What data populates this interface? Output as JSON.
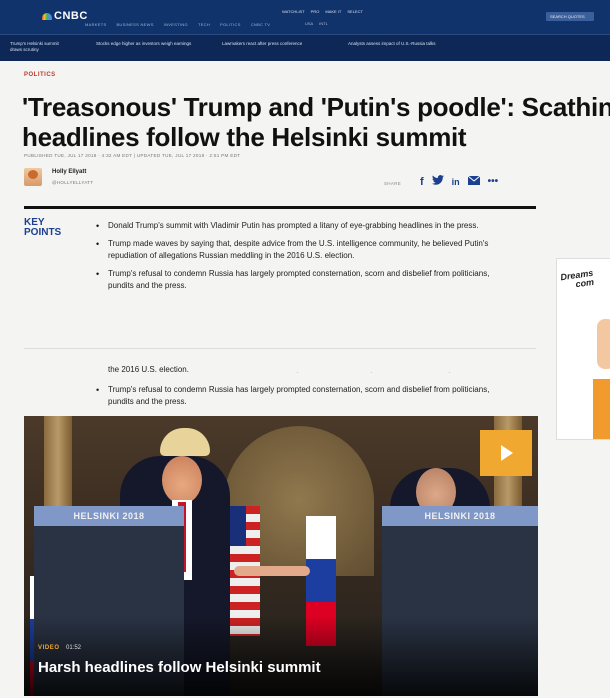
{
  "header": {
    "logo": "CNBC",
    "nav": [
      "MARKETS",
      "BUSINESS NEWS",
      "INVESTING",
      "TECH",
      "POLITICS",
      "CNBC TV"
    ],
    "right_links": [
      "WATCHLIST",
      "PRO",
      "MAKE IT",
      "SELECT"
    ],
    "right_links_row2": [
      "USA",
      "INTL"
    ],
    "search_label": "SEARCH QUOTES"
  },
  "ticker": [
    "Trump's Helsinki summit draws scrutiny",
    "Stocks edge higher as investors weigh earnings",
    "Lawmakers react after press conference",
    "Analysts assess impact of U.S.-Russia talks"
  ],
  "article": {
    "section": "POLITICS",
    "headline_line1": "'Treasonous' Trump and 'Putin's poodle': Scathing",
    "headline_line2": "headlines follow the Helsinki summit",
    "dateline": "PUBLISHED TUE, JUL 17 2018 · 4:32 AM EDT | UPDATED TUE, JUL 17 2018 · 2:51 PM EDT",
    "author_name": "Holly Ellyatt",
    "author_handle": "@HOLLYELLYATT",
    "share_label": "SHARE",
    "share_icons": [
      "facebook-icon",
      "twitter-icon",
      "linkedin-icon",
      "email-icon",
      "more-icon"
    ],
    "key_points_title": "KEY POINTS",
    "key_points": [
      "Donald Trump's summit with Vladimir Putin has prompted a litany of eye-grabbing headlines in the press.",
      "Trump made waves by saying that, despite advice from the U.S. intelligence community, he believed Putin's repudiation of allegations Russian meddling in the 2016 U.S. election.",
      "Trump's refusal to condemn Russia has largely prompted consternation, scorn and disbelief from politicians, pundits and the press."
    ],
    "repeat_line": "the 2016 U.S. election.",
    "repeat_point": "Trump's refusal to condemn Russia has largely prompted consternation, scorn and disbelief from politicians, pundits and the press."
  },
  "video": {
    "podium_left": "HELSINKI 2018",
    "podium_right": "HELSINKI 2018",
    "tag": "VIDEO",
    "duration": "01:52",
    "title": "Harsh headlines follow Helsinki summit"
  },
  "ad": {
    "text_line1": "Dreams",
    "text_line2": "com"
  }
}
